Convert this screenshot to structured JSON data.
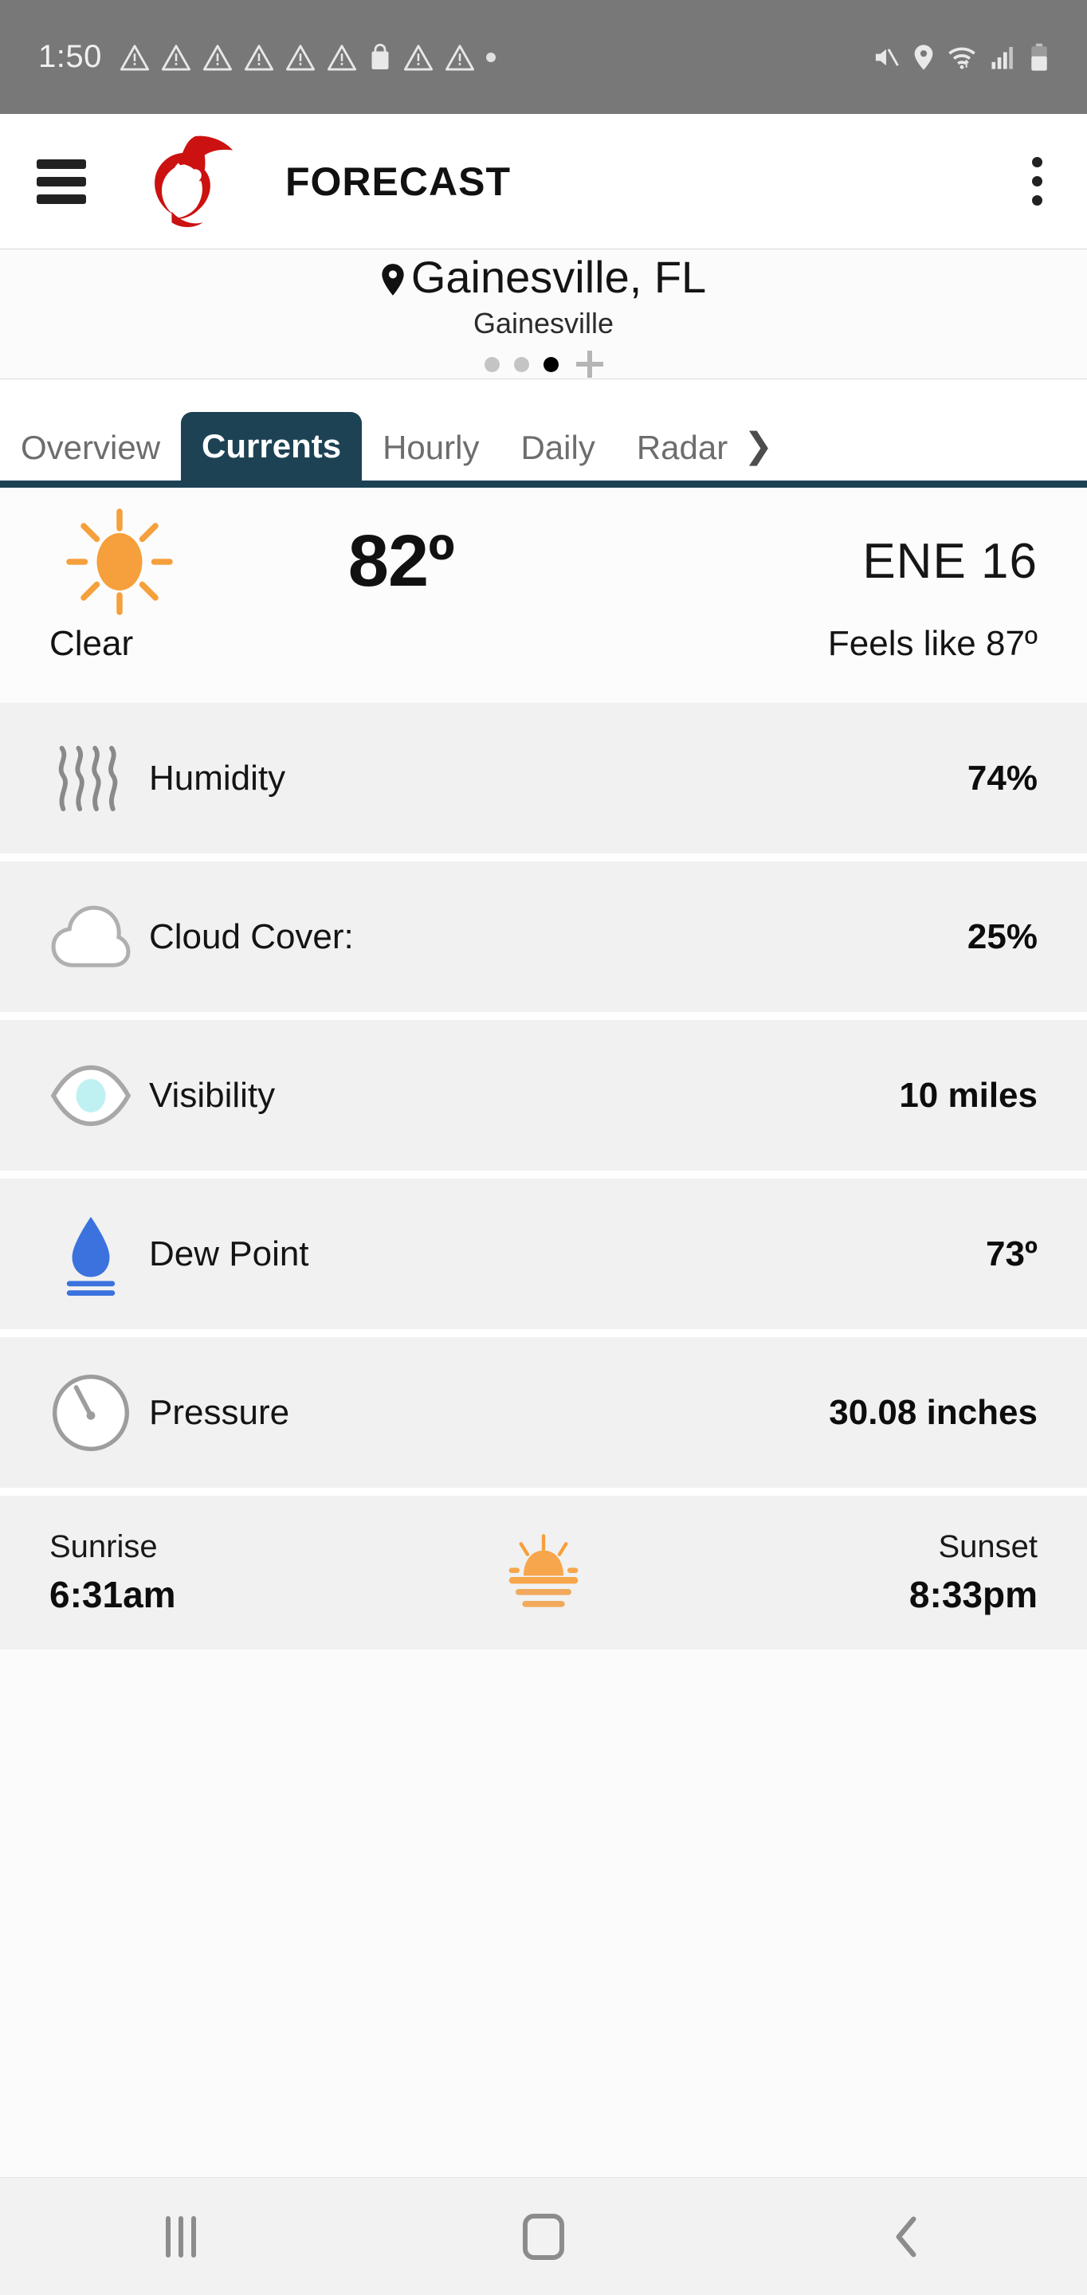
{
  "status_bar": {
    "time": "1:50",
    "left_icons": [
      "warning-triangle-icon",
      "warning-triangle-icon",
      "warning-triangle-icon",
      "warning-triangle-icon",
      "warning-triangle-icon",
      "warning-triangle-icon",
      "shopping-bag-icon",
      "warning-triangle-icon",
      "warning-triangle-icon",
      "dot-icon"
    ],
    "right_icons": [
      "mute-icon",
      "location-icon",
      "wifi-icon",
      "cellular-signal-icon",
      "battery-icon"
    ],
    "background": "#787878"
  },
  "header": {
    "menu_icon": "hamburger-menu-icon",
    "logo_icon": "hurricane-logo-icon",
    "title": "FORECAST",
    "overflow_icon": "more-vertical-icon",
    "logo_color": "#CC1111"
  },
  "location": {
    "pin_icon": "map-pin-icon",
    "primary": "Gainesville, FL",
    "secondary": "Gainesville",
    "pager": {
      "dots": 3,
      "active_index": 2,
      "add_label": "+"
    }
  },
  "tabs": {
    "items": [
      {
        "label": "Overview",
        "active": false
      },
      {
        "label": "Currents",
        "active": true
      },
      {
        "label": "Hourly",
        "active": false
      },
      {
        "label": "Daily",
        "active": false
      },
      {
        "label": "Radar",
        "active": false
      }
    ],
    "scroll_arrow": "❯",
    "active_color": "#1d4254",
    "inactive_color": "#6d6d6d"
  },
  "current": {
    "condition_icon": "sun-icon",
    "temperature": "82º",
    "wind": "ENE  16",
    "condition": "Clear",
    "feels_like": "Feels like 87º",
    "sun_color": "#F5A03C"
  },
  "details": [
    {
      "icon": "humidity-waves-icon",
      "label": "Humidity",
      "value": "74%"
    },
    {
      "icon": "cloud-icon",
      "label": "Cloud Cover:",
      "value": "25%"
    },
    {
      "icon": "eye-visibility-icon",
      "label": "Visibility",
      "value": "10 miles"
    },
    {
      "icon": "water-droplet-icon",
      "label": "Dew Point",
      "value": "73º"
    },
    {
      "icon": "barometer-gauge-icon",
      "label": "Pressure",
      "value": "30.08 inches"
    }
  ],
  "sun_times": {
    "sunrise_label": "Sunrise",
    "sunrise_time": "6:31am",
    "sunset_label": "Sunset",
    "sunset_time": "8:33pm",
    "icon": "sunrise-icon"
  },
  "nav_bar": {
    "recents_icon": "recents-icon",
    "home_icon": "home-icon",
    "back_icon": "back-icon"
  }
}
